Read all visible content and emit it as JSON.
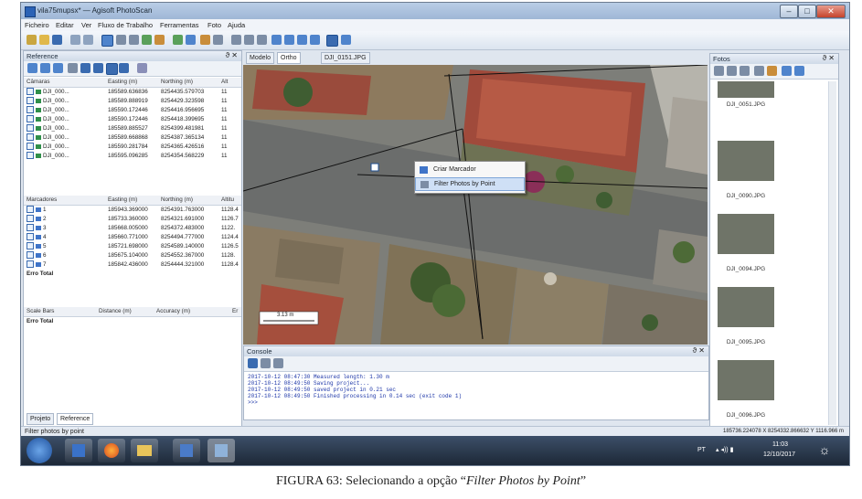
{
  "window": {
    "title": "vila75mupsx* — Agisoft PhotoScan"
  },
  "menu": [
    "Ficheiro",
    "Editar",
    "Ver",
    "Fluxo de Trabalho",
    "Ferramentas",
    "Foto",
    "Ajuda"
  ],
  "reference": {
    "title": "Reference",
    "cameras_header": [
      "Câmaras",
      "Easting (m)",
      "Northing (m)",
      "Alt"
    ],
    "cameras": [
      [
        "DJI_000...",
        "185589.636836",
        "8254435.579703",
        "11"
      ],
      [
        "DJI_000...",
        "185589.888919",
        "8254429.323598",
        "11"
      ],
      [
        "DJI_000...",
        "185590.172446",
        "8254416.956695",
        "11"
      ],
      [
        "DJI_000...",
        "185590.172446",
        "8254418.399695",
        "11"
      ],
      [
        "DJI_000...",
        "185589.885527",
        "8254399.481981",
        "11"
      ],
      [
        "DJI_000...",
        "185589.668868",
        "8254387.365134",
        "11"
      ],
      [
        "DJI_000...",
        "185590.281784",
        "8254365.426516",
        "11"
      ],
      [
        "DJI_000...",
        "185595.096285",
        "8254354.568229",
        "11"
      ]
    ],
    "markers_header": [
      "Marcadores",
      "Easting (m)",
      "Northing (m)",
      "Altitu"
    ],
    "markers": [
      [
        "1",
        "185943.369000",
        "8254391.763000",
        "1128.4"
      ],
      [
        "2",
        "185733.360000",
        "8254321.691000",
        "1126.7"
      ],
      [
        "3",
        "185668.005000",
        "8254372.483000",
        "1122."
      ],
      [
        "4",
        "185660.771000",
        "8254494.777000",
        "1124.4"
      ],
      [
        "5",
        "185721.698000",
        "8254589.140000",
        "1126.5"
      ],
      [
        "6",
        "185675.104000",
        "8254552.367000",
        "1128."
      ],
      [
        "7",
        "185842.436000",
        "8254444.321000",
        "1128.4"
      ]
    ],
    "markers_total": "Erro Total",
    "scalebars_header": [
      "Scale Bars",
      "Distance (m)",
      "Accuracy (m)",
      "Er"
    ],
    "scalebars_total": "Erro Total",
    "bottom_tabs": [
      "Projeto",
      "Reference"
    ]
  },
  "view_tabs": [
    "Modelo",
    "Ortho",
    "DJI_0151.JPG"
  ],
  "map": {
    "scale_label": "3.13 m"
  },
  "context_menu": {
    "items": [
      "Criar Marcador",
      "Filter Photos by Point"
    ]
  },
  "console": {
    "title": "Console",
    "lines": [
      "2017-10-12 08:47:30 Measured length: 1.30 m",
      "2017-10-12 08:49:50 Saving project...",
      "2017-10-12 08:49:50 saved project in 0.21 sec",
      "2017-10-12 08:49:50 Finished processing in 0.14 sec (exit code 1)",
      ">>>"
    ]
  },
  "photos": {
    "title": "Fotos",
    "items": [
      "DJI_0051.JPG",
      "DJI_0090.JPG",
      "DJI_0094.JPG",
      "DJI_0095.JPG",
      "DJI_0096.JPG"
    ]
  },
  "status": {
    "left": "Filter photos by point",
    "coords": "185736.224078 X 8254332.866632 Y 1116.966 m"
  },
  "taskbar": {
    "lang": "PT",
    "time": "11:03",
    "date": "12/10/2017"
  },
  "caption": {
    "prefix": "FIGURA 63: Selecionando a opção “",
    "italic": "Filter Photos by Point",
    "suffix": "”"
  },
  "colors": {
    "accent": "#2b62b5",
    "highlight": "#cfe0f6",
    "marker_flag": "#3f74c8",
    "console_text": "#1d36a8"
  }
}
